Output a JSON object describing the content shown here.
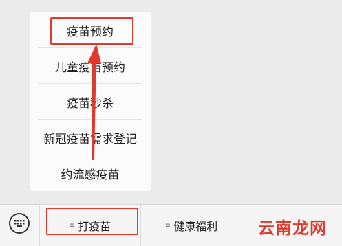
{
  "menu": {
    "items": [
      {
        "label": "疫苗预约"
      },
      {
        "label": "儿童疫苗预约"
      },
      {
        "label": "疫苗秒杀"
      },
      {
        "label": "新冠疫苗需求登记"
      },
      {
        "label": "约流感疫苗"
      }
    ]
  },
  "tabbar": {
    "keyboard_icon": "keyboard-icon",
    "tabs": [
      {
        "label": "打疫苗",
        "icon": "menu-lines-icon"
      },
      {
        "label": "健康福利",
        "icon": "menu-lines-icon"
      }
    ]
  },
  "watermark": {
    "text": "云南龙网"
  },
  "colors": {
    "highlight": "#e03a2e",
    "popup_bg": "#fbfbfb",
    "background": "#ebebeb"
  }
}
